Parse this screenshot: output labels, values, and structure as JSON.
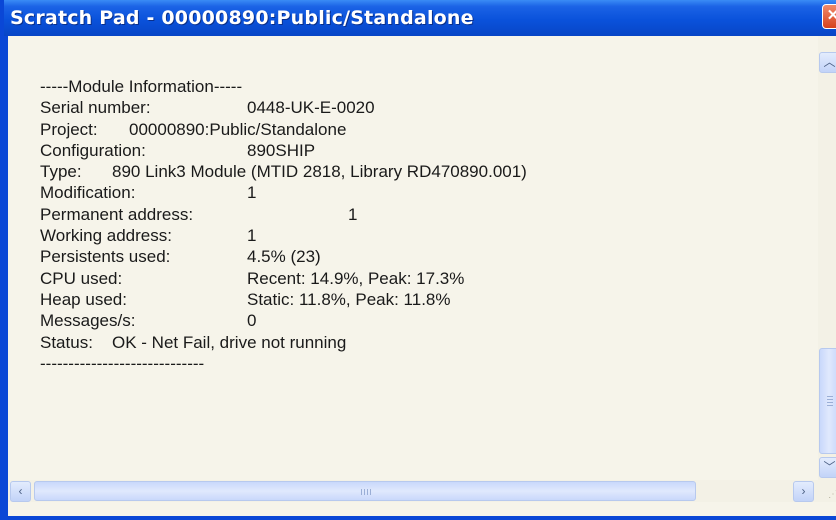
{
  "window": {
    "title": "Scratch Pad - 00000890:Public/Standalone"
  },
  "icons": {
    "close": "close-icon",
    "up": "up-arrow-icon",
    "down": "down-arrow-icon",
    "left": "left-arrow-icon",
    "right": "right-arrow-icon"
  },
  "lines": [
    {
      "label": "-----Module Information-----",
      "value": ""
    },
    {
      "label": "Serial number:",
      "value": "0448-UK-E-0020"
    },
    {
      "label": "Project:",
      "value": "00000890:Public/Standalone"
    },
    {
      "label": "Configuration:",
      "value": "890SHIP"
    },
    {
      "label": "Type:",
      "value": "890 Link3 Module (MTID 2818, Library RD470890.001)"
    },
    {
      "label": "Modification:",
      "value": "1"
    },
    {
      "label": "Permanent address:",
      "value": "1"
    },
    {
      "label": "Working address:",
      "value": "1"
    },
    {
      "label": "Persistents used:",
      "value": "4.5% (23)"
    },
    {
      "label": "CPU used:",
      "value": "Recent: 14.9%, Peak: 17.3%"
    },
    {
      "label": "Heap used:",
      "value": "Static: 11.8%, Peak: 11.8%"
    },
    {
      "label": "Messages/s:",
      "value": "0"
    },
    {
      "label": "Status:",
      "value": "OK - Net Fail, drive not running"
    },
    {
      "label": "-----------------------------",
      "value": ""
    }
  ]
}
